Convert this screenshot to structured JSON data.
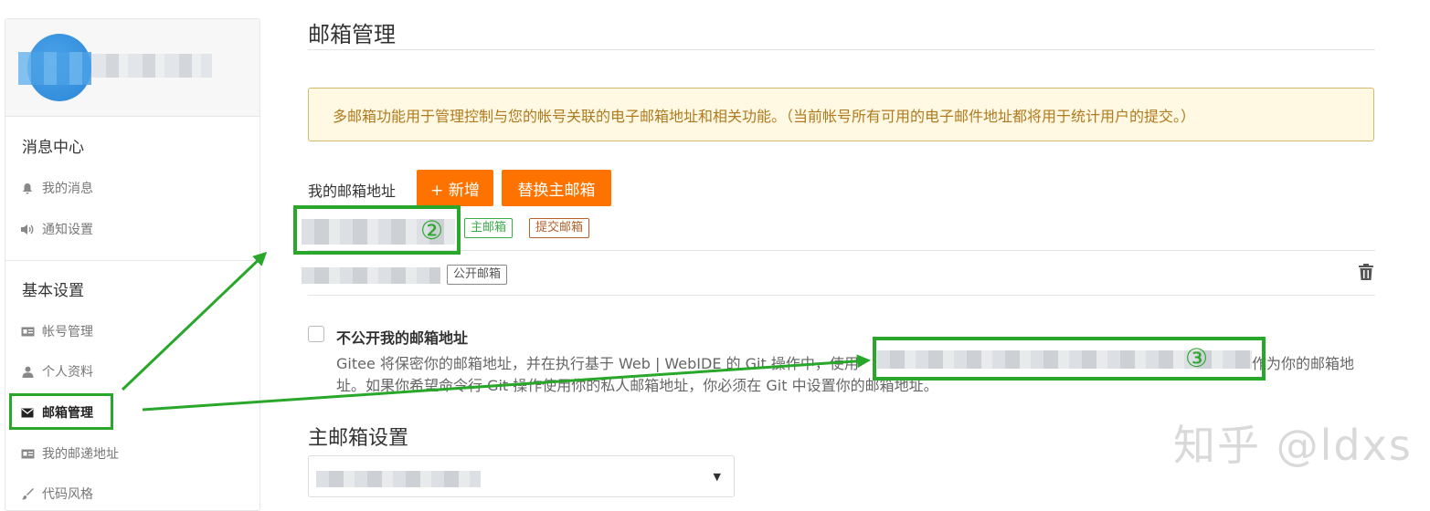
{
  "sidebar": {
    "groups": [
      {
        "title": "消息中心",
        "items": [
          {
            "label": "我的消息",
            "icon": "bell-icon"
          },
          {
            "label": "通知设置",
            "icon": "speaker-icon"
          }
        ]
      },
      {
        "title": "基本设置",
        "items": [
          {
            "label": "帐号管理",
            "icon": "id-card-icon"
          },
          {
            "label": "个人资料",
            "icon": "user-icon"
          },
          {
            "label": "邮箱管理",
            "icon": "envelope-icon",
            "active": true
          },
          {
            "label": "我的邮递地址",
            "icon": "address-card-icon"
          },
          {
            "label": "代码风格",
            "icon": "brush-icon"
          }
        ]
      }
    ]
  },
  "main": {
    "title": "邮箱管理",
    "notice": "多邮箱功能用于管理控制与您的帐号关联的电子邮箱地址和相关功能。（当前帐号所有可用的电子邮件地址都将用于统计用户的提交。）",
    "my_email_label": "我的邮箱地址",
    "add_button": "+ 新增",
    "switch_primary_button": "替换主邮箱",
    "emails": [
      {
        "tags": [
          "主邮箱",
          "提交邮箱"
        ]
      },
      {
        "tags": [
          "公开邮箱"
        ]
      }
    ],
    "private": {
      "title": "不公开我的邮箱地址",
      "line1": "Gitee 将保密你的邮箱地址，并在执行基于 Web | WebIDE 的 Git 操作中，使用",
      "line1_end": "作为你的邮箱地",
      "line2": "址。如果你希望命令行 Git 操作使用你的私人邮箱地址，你必须在 Git 中设置你的邮箱地址。"
    },
    "primary_settings_title": "主邮箱设置"
  },
  "annotations": {
    "marker_2": "②",
    "marker_3": "③",
    "color": "#29a72a"
  },
  "watermark": "知乎 @ldxs",
  "colors": {
    "accent_orange": "#fe7300",
    "notice_bg": "#fff8e3",
    "notice_text": "#b07a1e",
    "tag_green": "#3aab49",
    "tag_brown": "#b4612c"
  }
}
